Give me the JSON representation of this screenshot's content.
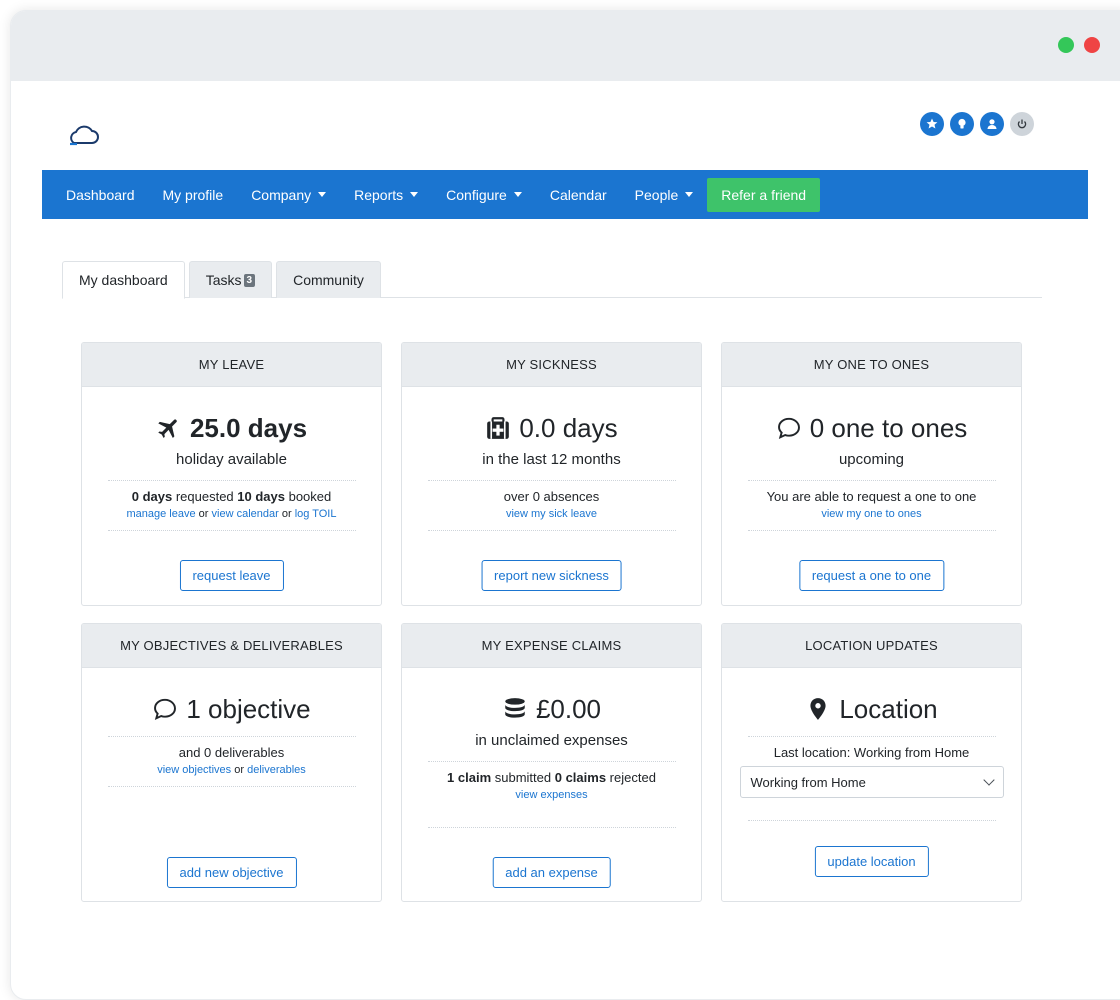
{
  "colors": {
    "primary": "#1b75d0",
    "success": "#3ec36a",
    "header_bg": "#e9ecef"
  },
  "nav": {
    "items": [
      {
        "label": "Dashboard",
        "dropdown": false
      },
      {
        "label": "My profile",
        "dropdown": false
      },
      {
        "label": "Company",
        "dropdown": true
      },
      {
        "label": "Reports",
        "dropdown": true
      },
      {
        "label": "Configure",
        "dropdown": true
      },
      {
        "label": "Calendar",
        "dropdown": false
      },
      {
        "label": "People",
        "dropdown": true
      }
    ],
    "refer": "Refer a friend"
  },
  "header_icons": [
    "star-icon",
    "lightbulb-icon",
    "user-icon",
    "power-icon"
  ],
  "tabs": [
    {
      "label": "My dashboard"
    },
    {
      "label": "Tasks",
      "badge": "3"
    },
    {
      "label": "Community"
    }
  ],
  "cards": {
    "leave": {
      "header": "MY LEAVE",
      "icon": "plane-icon",
      "big": "25.0 days",
      "sub": "holiday available",
      "d_a": "0 days",
      "d_b": " requested ",
      "d_c": "10 days",
      "d_d": " booked",
      "l_a": "manage leave",
      "l_b": " or ",
      "l_c": "view calendar",
      "l_d": " or ",
      "l_e": "log TOIL",
      "button": "request leave"
    },
    "sickness": {
      "header": "MY SICKNESS",
      "icon": "first-aid-icon",
      "big": "0.0 days",
      "sub": "in the last 12 months",
      "detail": "over 0 absences",
      "link": "view my sick leave",
      "button": "report new sickness"
    },
    "onetoones": {
      "header": "MY ONE TO ONES",
      "icon": "comment-icon",
      "big": "0 one to ones",
      "sub": "upcoming",
      "detail": "You are able to request a one to one",
      "link": "view my one to ones",
      "button": "request a one to one"
    },
    "objectives": {
      "header": "MY OBJECTIVES & DELIVERABLES",
      "icon": "comment-icon",
      "big": "1 objective",
      "detail": "and 0 deliverables",
      "l_a": "view objectives",
      "l_b": " or ",
      "l_c": "deliverables",
      "button": "add new objective"
    },
    "expenses": {
      "header": "MY EXPENSE CLAIMS",
      "icon": "coins-icon",
      "big": "£0.00",
      "sub": "in unclaimed expenses",
      "d_a": "1 claim",
      "d_b": " submitted ",
      "d_c": "0 claims",
      "d_d": " rejected",
      "link": "view expenses",
      "button": "add an expense"
    },
    "location": {
      "header": "LOCATION UPDATES",
      "icon": "map-pin-icon",
      "big": "Location",
      "detail": "Last location: Working from Home",
      "select_value": "Working from Home",
      "button": "update location"
    }
  }
}
